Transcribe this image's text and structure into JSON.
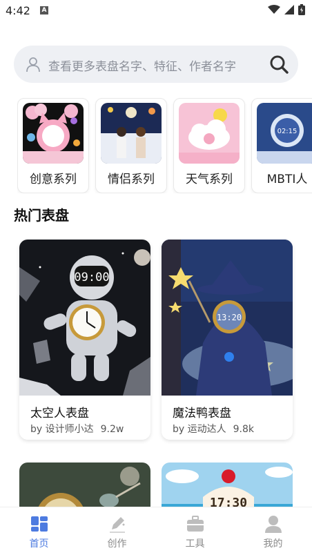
{
  "status": {
    "time": "4:42",
    "notif_letter": "A"
  },
  "search": {
    "placeholder": "查看更多表盘名字、特征、作者名字"
  },
  "categories": [
    {
      "label": "创意系列"
    },
    {
      "label": "情侣系列"
    },
    {
      "label": "天气系列"
    },
    {
      "label": "MBTI人"
    }
  ],
  "section": {
    "title": "热门表盘"
  },
  "dials": [
    {
      "name": "太空人表盘",
      "author": "by 设计师小达",
      "views": "9.2w",
      "clock_text": "09:00"
    },
    {
      "name": "魔法鸭表盘",
      "author": "by 运动达人",
      "views": "9.8k",
      "clock_text": "13:20"
    }
  ],
  "partial_dials": [
    {
      "clock_text": ""
    },
    {
      "clock_text": "17:30"
    }
  ],
  "tabs": [
    {
      "label": "首页",
      "icon": "grid-icon",
      "active": true
    },
    {
      "label": "创作",
      "icon": "pen-icon",
      "active": false
    },
    {
      "label": "工具",
      "icon": "toolbox-icon",
      "active": false
    },
    {
      "label": "我的",
      "icon": "person-icon",
      "active": false
    }
  ],
  "colors": {
    "accent": "#4d7be0",
    "search_bg": "#eef0f4"
  }
}
